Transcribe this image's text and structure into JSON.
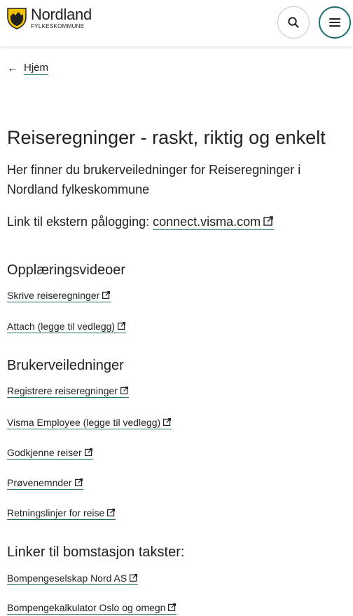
{
  "header": {
    "logo": {
      "name": "Nordland",
      "sub": "FYLKESKOMMUNE",
      "shield_color": "#f2c200"
    },
    "search_icon": "search-icon",
    "menu_icon": "hamburger-menu-icon",
    "accent": "#1f6f73"
  },
  "breadcrumb": {
    "arrow": "←",
    "label": "Hjem"
  },
  "page": {
    "title": "Reiseregninger - raskt, riktig og enkelt",
    "intro": "Her finner du brukerveiledninger for Reiseregninger i Nordland fylkeskommune",
    "external_prefix": "Link til ekstern pålogging: ",
    "external_link": "connect.visma.com"
  },
  "sections": [
    {
      "heading": "Opplæringsvideoer",
      "links": [
        "Skrive reiseregninger",
        "Attach (legge til vedlegg)"
      ]
    },
    {
      "heading": "Brukerveiledninger",
      "links": [
        "Registrere reiseregninger",
        "Visma Employee (legge til vedlegg)",
        "Godkjenne reiser",
        "Prøvenemnder",
        "Retningslinjer for reise"
      ]
    },
    {
      "heading": "Linker til bomstasjon takster:",
      "links": [
        "Bompengeselskap Nord AS",
        "Bompengekalkulator Oslo og omegn"
      ]
    }
  ]
}
